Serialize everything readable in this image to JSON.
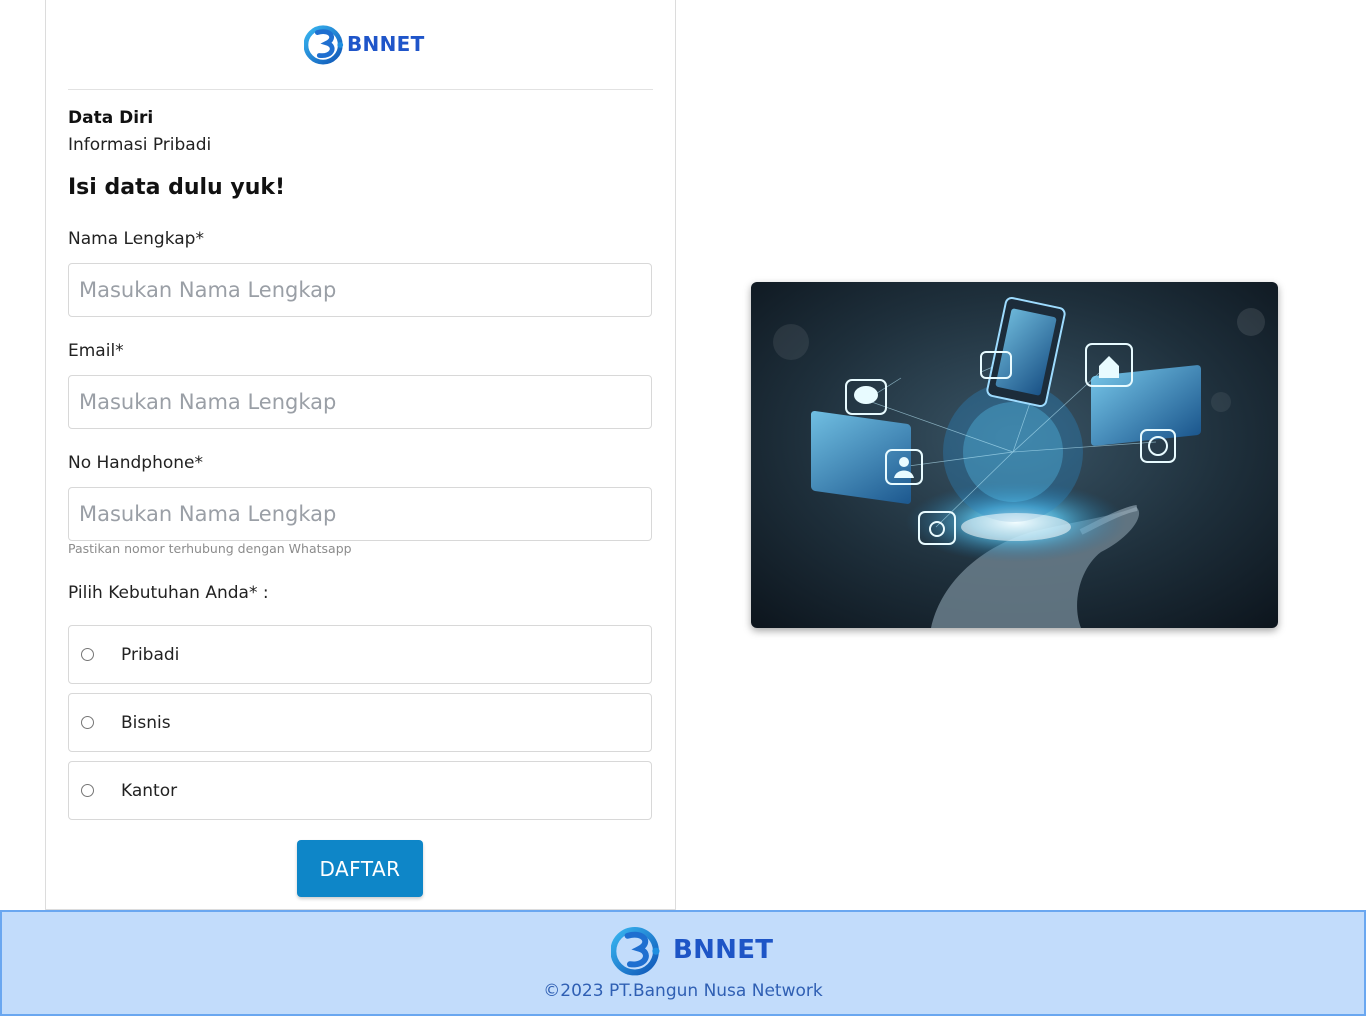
{
  "brand": {
    "name": "BNNET",
    "color": "#1f55c9"
  },
  "form": {
    "section_title": "Data Diri",
    "section_subtitle": "Informasi Pribadi",
    "heading": "Isi data dulu yuk!",
    "fields": [
      {
        "label": "Nama Lengkap*",
        "placeholder": "Masukan Nama Lengkap",
        "value": ""
      },
      {
        "label": "Email*",
        "placeholder": "Masukan Nama Lengkap",
        "value": ""
      },
      {
        "label": "No Handphone*",
        "placeholder": "Masukan Nama Lengkap",
        "value": ""
      }
    ],
    "phone_hint": "Pastikan nomor terhubung dengan Whatsapp",
    "needs_label": "Pilih Kebutuhan Anda* :",
    "options": [
      {
        "label": "Pribadi",
        "checked": false
      },
      {
        "label": "Bisnis",
        "checked": false
      },
      {
        "label": "Kantor",
        "checked": false
      }
    ],
    "submit_label": "DAFTAR",
    "submit_color": "#0e86c8"
  },
  "hero_image": {
    "icon": "technology-network-hand-image"
  },
  "footer": {
    "brand_name": "BNNET",
    "copyright": "©2023 PT.Bangun Nusa Network",
    "background": "#c2dcfb"
  }
}
